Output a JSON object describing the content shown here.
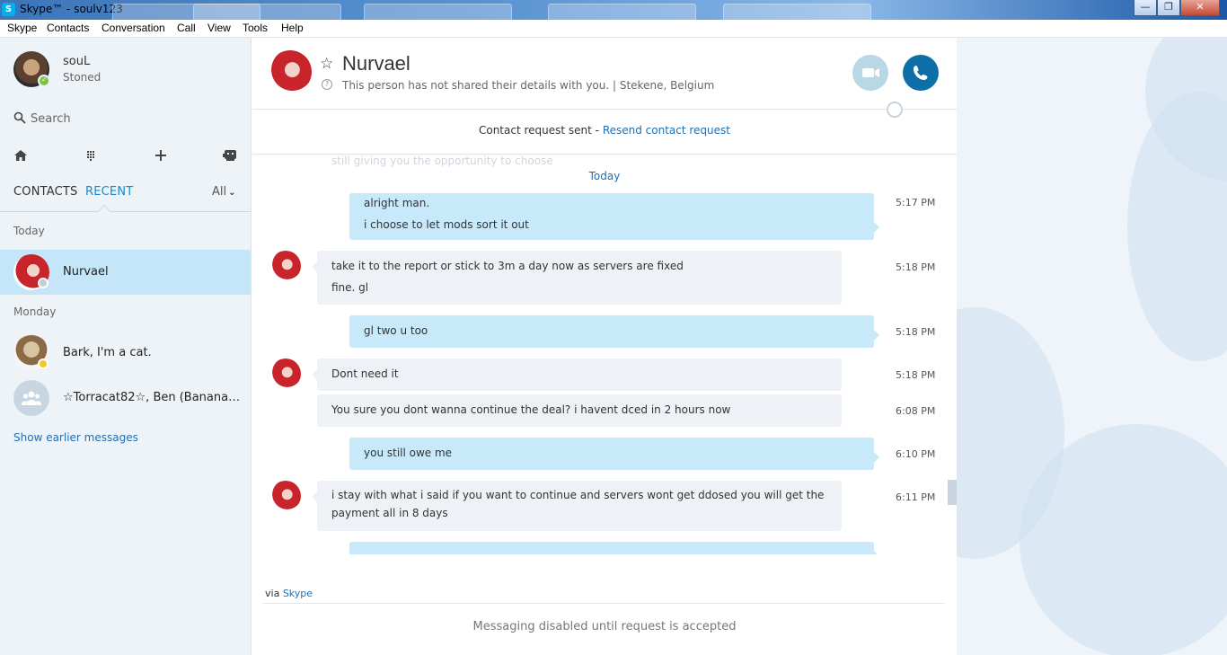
{
  "window": {
    "title": "Skype™ - soulv123",
    "app_icon_letter": "S",
    "controls": {
      "minimize": "—",
      "maximize": "❐",
      "close": "✕"
    }
  },
  "menu": [
    "Skype",
    "Contacts",
    "Conversation",
    "Call",
    "View",
    "Tools",
    "Help"
  ],
  "profile": {
    "name": "souL",
    "mood": "Stoned",
    "status_color": "#7dc243"
  },
  "search": {
    "placeholder": "Search"
  },
  "toolbar_icons": [
    "home-icon",
    "dialpad-icon",
    "add-icon",
    "bot-icon"
  ],
  "tabs": {
    "contacts": "CONTACTS",
    "recent": "RECENT",
    "filter": "All"
  },
  "recent": {
    "groups": [
      {
        "label": "Today",
        "items": [
          {
            "name": "Nurvael",
            "active": true
          }
        ]
      },
      {
        "label": "Monday",
        "items": [
          {
            "name": "Bark, I'm a cat."
          },
          {
            "name": "☆Torracat82☆, Ben (Bananastr..."
          }
        ]
      }
    ],
    "show_earlier": "Show earlier messages"
  },
  "conversation": {
    "name": "Nurvael",
    "info": "This person has not shared their details with you.  |  Stekene, Belgium",
    "request_text": "Contact request sent - ",
    "request_link": "Resend contact request",
    "ghost_text": "still giving you the opportunity to choose",
    "day": "Today",
    "messages": [
      {
        "dir": "out",
        "lines": [
          "alright man.",
          "i choose to let mods sort it out"
        ],
        "time": "5:17 PM"
      },
      {
        "dir": "in",
        "lines": [
          "take it to the report or stick to 3m a day now as servers are fixed",
          "fine. gl"
        ],
        "time": "5:18 PM"
      },
      {
        "dir": "out",
        "lines": [
          "gl two u too"
        ],
        "time": "5:18 PM"
      },
      {
        "dir": "in",
        "lines": [
          "Dont need it"
        ],
        "time": "5:18 PM"
      },
      {
        "dir": "in",
        "lines": [
          "You sure you dont wanna continue the deal? i havent dced in 2 hours now"
        ],
        "time": "6:08 PM"
      },
      {
        "dir": "out",
        "lines": [
          "you still owe me"
        ],
        "time": "6:10 PM"
      },
      {
        "dir": "in",
        "lines": [
          "i stay with what i said if you want to continue and servers wont get ddosed you will get the payment all in 8 days"
        ],
        "time": "6:11 PM"
      }
    ],
    "via_prefix": "via ",
    "via_link": "Skype",
    "disabled_notice": "Messaging disabled until request is accepted"
  },
  "colors": {
    "accent": "#1f86c9",
    "outgoing_bubble": "#c7e9fa",
    "incoming_bubble": "#eef1f5",
    "call_button": "#0e6ea8"
  }
}
